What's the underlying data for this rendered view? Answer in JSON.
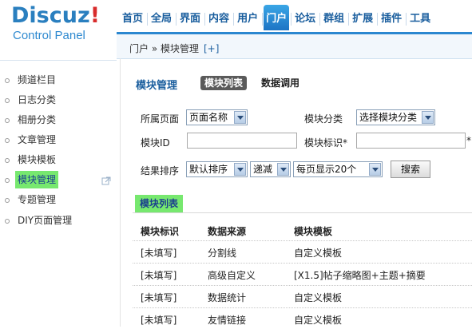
{
  "logo": {
    "main": "Discuz",
    "exclaim": "!",
    "sub": "Control Panel"
  },
  "topnav": [
    "首页",
    "全局",
    "界面",
    "内容",
    "用户",
    "门户",
    "论坛",
    "群组",
    "扩展",
    "插件",
    "工具"
  ],
  "topnav_active": "门户",
  "breadcrumb": {
    "text": "门户 » 模块管理",
    "add": "[+]"
  },
  "sidebar": {
    "items": [
      "频道栏目",
      "日志分类",
      "相册分类",
      "文章管理",
      "模块模板",
      "模块管理",
      "专题管理",
      "DIY页面管理"
    ],
    "active": "模块管理"
  },
  "main": {
    "title": "模块管理",
    "tabs": {
      "list": "模块列表",
      "call": "数据调用"
    },
    "filters": {
      "page_label": "所属页面",
      "page_value": "页面名称",
      "category_label": "模块分类",
      "category_value": "选择模块分类",
      "id_label": "模块ID",
      "ident_label": "模块标识*",
      "ident_star": "*",
      "sort_label": "结果排序",
      "sort_value": "默认排序",
      "order_value": "递减",
      "perpage_value": "每页显示20个",
      "search_button": "搜索"
    },
    "section_label": "模块列表",
    "table": {
      "headers": [
        "模块标识",
        "数据来源",
        "模块模板"
      ],
      "rows": [
        [
          "[未填写]",
          "分割线",
          "自定义模板"
        ],
        [
          "[未填写]",
          "高级自定义",
          "[X1.5]帖子缩略图+主题+摘要"
        ],
        [
          "[未填写]",
          "数据统计",
          "自定义模板"
        ],
        [
          "[未填写]",
          "友情链接",
          "自定义模板"
        ]
      ]
    }
  },
  "colors": {
    "accent": "#2b87d0",
    "highlight": "#77e86f",
    "nav_text": "#1a5e9e"
  }
}
